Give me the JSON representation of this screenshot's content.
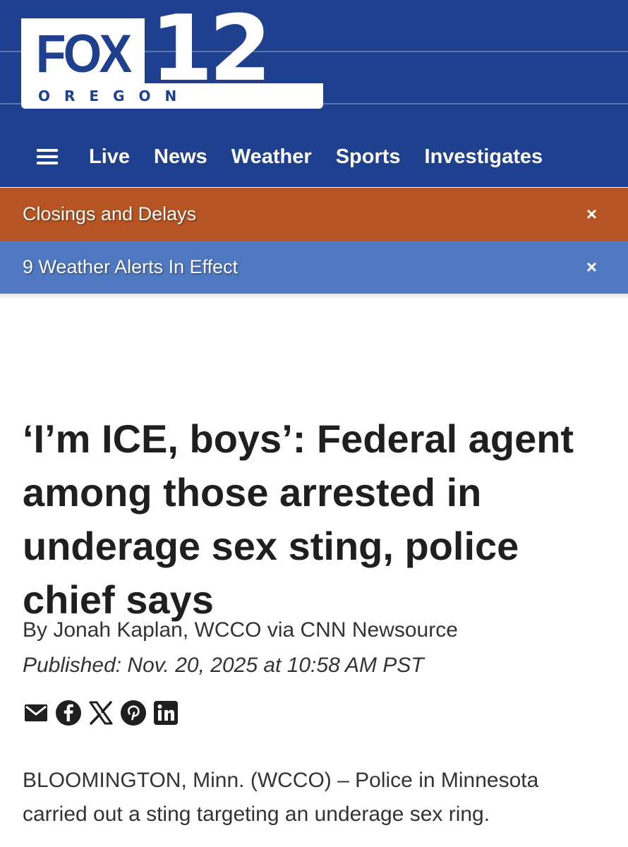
{
  "logo": {
    "fox": "FOX",
    "number": "12",
    "region": "OREGON"
  },
  "nav": {
    "menu_icon": "hamburger-menu-icon",
    "items": [
      "Live",
      "News",
      "Weather",
      "Sports",
      "Investigates"
    ]
  },
  "alerts": [
    {
      "label": "Closings and Delays",
      "close": "×",
      "color": "#b65523"
    },
    {
      "label": "9 Weather Alerts In Effect",
      "close": "×",
      "color": "#4f78c0"
    }
  ],
  "article": {
    "headline": "‘I’m ICE, boys’: Federal agent among those arrested in underage sex sting, police chief says",
    "byline": "By Jonah Kaplan, WCCO via CNN Newsource",
    "published": "Published: Nov. 20, 2025 at 10:58 AM PST",
    "share_icons": [
      "email-icon",
      "facebook-icon",
      "x-icon",
      "pinterest-icon",
      "linkedin-icon"
    ],
    "body": "BLOOMINGTON, Minn. (WCCO) – Police in Minnesota carried out a sting targeting an underage sex ring."
  },
  "colors": {
    "header_bg": "#1f3f8f",
    "text": "#1f1f1f"
  }
}
